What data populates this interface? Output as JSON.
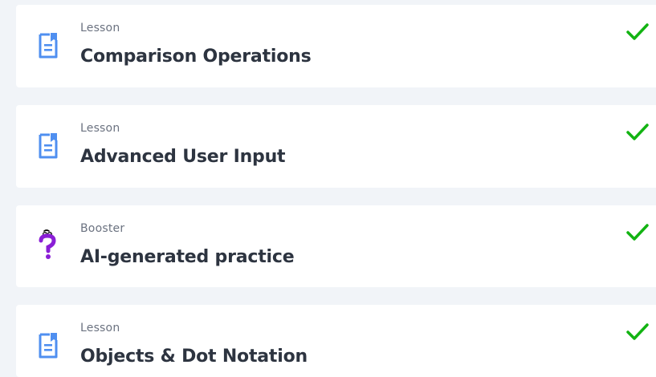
{
  "colors": {
    "page_bg": "#f1f4f8",
    "card_bg": "#ffffff",
    "lesson_icon": "#4f8ff0",
    "booster_icon": "#8a1ed6",
    "check": "#12b312",
    "title": "#2d3440",
    "type": "#6b7280"
  },
  "items": [
    {
      "type": "Lesson",
      "title": "Comparison Operations",
      "icon": "document-bookmark-icon",
      "status": "completed"
    },
    {
      "type": "Lesson",
      "title": "Advanced User Input",
      "icon": "document-bookmark-icon",
      "status": "completed"
    },
    {
      "type": "Booster",
      "title": "AI-generated practice",
      "icon": "question-mark-face-icon",
      "status": "completed"
    },
    {
      "type": "Lesson",
      "title": "Objects & Dot Notation",
      "icon": "document-bookmark-icon",
      "status": "completed"
    }
  ]
}
